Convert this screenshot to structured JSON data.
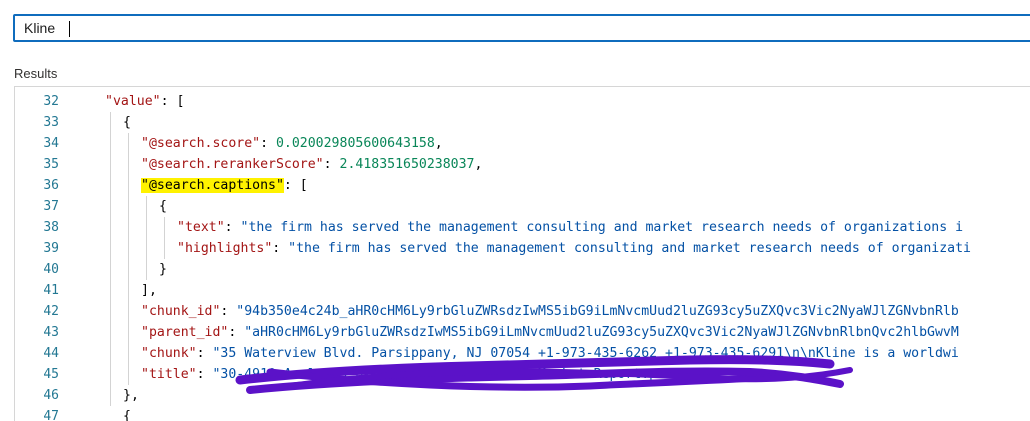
{
  "search": {
    "value": "Kline"
  },
  "results": {
    "label": "Results"
  },
  "editor": {
    "lines": [
      {
        "n": "32",
        "t": [
          [
            "k",
            "\"value\""
          ],
          [
            "p",
            ": ["
          ]
        ]
      },
      {
        "n": "33",
        "t": [
          [
            "p",
            "{"
          ]
        ]
      },
      {
        "n": "34",
        "t": [
          [
            "k",
            "\"@search.score\""
          ],
          [
            "p",
            ": "
          ],
          [
            "n",
            "0.020029805600643158"
          ],
          [
            "p",
            ","
          ]
        ]
      },
      {
        "n": "35",
        "t": [
          [
            "k",
            "\"@search.rerankerScore\""
          ],
          [
            "p",
            ": "
          ],
          [
            "n",
            "2.418351650238037"
          ],
          [
            "p",
            ","
          ]
        ]
      },
      {
        "n": "36",
        "t": [
          [
            "hl",
            "\"@search.captions\""
          ],
          [
            "p",
            ": ["
          ]
        ]
      },
      {
        "n": "37",
        "t": [
          [
            "p",
            "{"
          ]
        ]
      },
      {
        "n": "38",
        "t": [
          [
            "k",
            "\"text\""
          ],
          [
            "p",
            ": "
          ],
          [
            "s",
            "\"the firm has served the management consulting and market research needs of organizations i"
          ]
        ]
      },
      {
        "n": "39",
        "t": [
          [
            "k",
            "\"highlights\""
          ],
          [
            "p",
            ": "
          ],
          [
            "s",
            "\"the firm has served the management consulting and market research needs of organizati"
          ]
        ]
      },
      {
        "n": "40",
        "t": [
          [
            "p",
            "}"
          ]
        ]
      },
      {
        "n": "41",
        "t": [
          [
            "p",
            "],"
          ]
        ]
      },
      {
        "n": "42",
        "t": [
          [
            "k",
            "\"chunk_id\""
          ],
          [
            "p",
            ": "
          ],
          [
            "s",
            "\"94b350e4c24b_aHR0cHM6Ly9rbGluZWRsdzIwMS5ibG9iLmNvcmUud2luZG93cy5uZXQvc3Vic2NyaWJlZGNvbnRlb"
          ]
        ]
      },
      {
        "n": "43",
        "t": [
          [
            "k",
            "\"parent_id\""
          ],
          [
            "p",
            ": "
          ],
          [
            "s",
            "\"aHR0cHM6Ly9rbGluZWRsdzIwMS5ibG9iLmNvcmUud2luZG93cy5uZXQvc3Vic2NyaWJlZGNvbnRlbnQvc2hlbGwvM"
          ]
        ]
      },
      {
        "n": "44",
        "t": [
          [
            "k",
            "\"chunk\""
          ],
          [
            "p",
            ": "
          ],
          [
            "s",
            "\"35 Waterview Blvd. Parsippany, NJ 07054 +1-973-435-6262 +1-973-435-6291\\n\\nKline is a worldwi"
          ]
        ]
      },
      {
        "n": "45",
        "t": [
          [
            "k",
            "\"title\""
          ],
          [
            "p",
            ": "
          ],
          [
            "s",
            "\"30-4910 Analysis of Specialty Chemicals Market Report.pdf\""
          ]
        ]
      },
      {
        "n": "46",
        "t": [
          [
            "p",
            "},"
          ]
        ]
      },
      {
        "n": "47",
        "t": [
          [
            "p",
            "{"
          ]
        ]
      }
    ]
  },
  "colors": {
    "focus_border": "#0f6cbd",
    "line_number": "#237893",
    "json_key": "#a31515",
    "json_string": "#0451a5",
    "json_number": "#098658",
    "highlight": "#fff200",
    "redaction": "#5b12c8"
  }
}
